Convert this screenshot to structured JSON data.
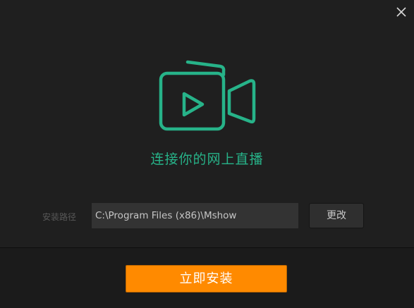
{
  "window": {
    "close_icon": "close-icon"
  },
  "hero": {
    "logo_icon": "video-camera-play-icon",
    "tagline": "连接你的网上直播",
    "accent_color": "#27b389"
  },
  "install_path": {
    "label": "安装路径",
    "value": "C:\\Program Files (x86)\\Mshow",
    "change_label": "更改"
  },
  "footer": {
    "install_label": "立即安装",
    "install_color": "#ff8a00"
  }
}
